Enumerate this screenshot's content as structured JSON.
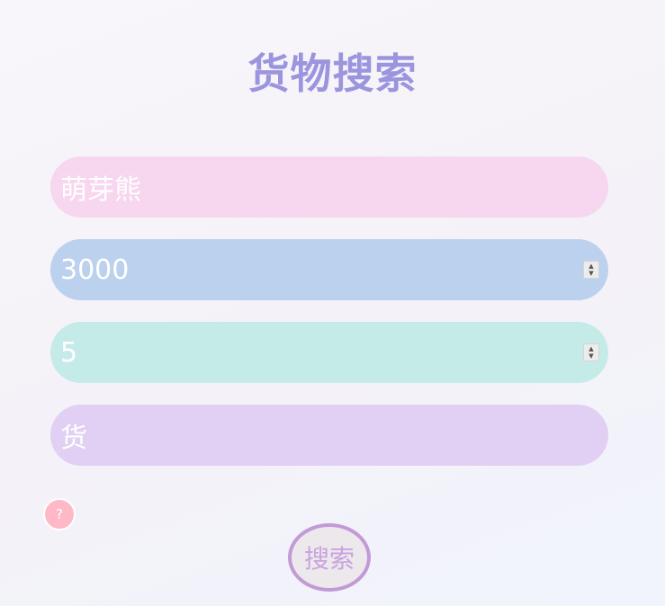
{
  "page": {
    "title": "货物搜索"
  },
  "form": {
    "name_value": "萌芽熊",
    "price_value": "3000",
    "quantity_value": "5",
    "category_value": "货"
  },
  "help": {
    "label": "?"
  },
  "search_button": {
    "label": "搜索"
  },
  "colors": {
    "title": "#9b95de",
    "name_field": "#f7d6ef",
    "price_field": "#bcd1ee",
    "quantity_field": "#c5ebe9",
    "category_field": "#e1d0f3",
    "help_button": "#ffb8c6",
    "search_border": "#c29ad6"
  }
}
